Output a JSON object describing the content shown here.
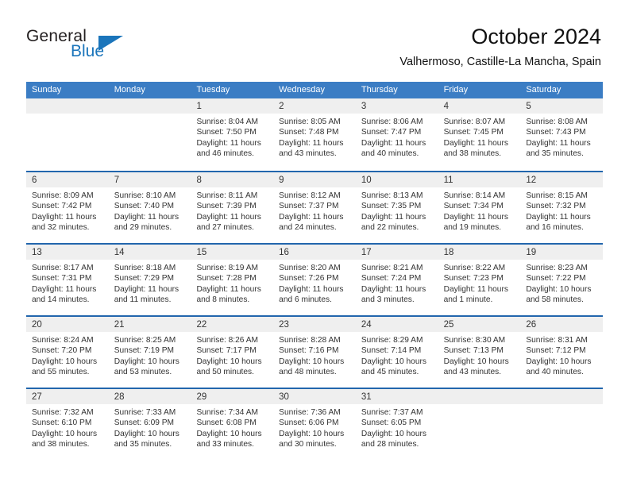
{
  "brand": {
    "word1": "General",
    "word2": "Blue",
    "accent_color": "#1b75bb",
    "triangle_icon": "triangle-logo-icon"
  },
  "header": {
    "title": "October 2024",
    "subtitle": "Valhermoso, Castille-La Mancha, Spain"
  },
  "theme": {
    "header_row_bg": "#3b7dc4",
    "row_divider": "#2266ad",
    "day_band_bg": "#efefef",
    "text": "#333333"
  },
  "weekdays": [
    "Sunday",
    "Monday",
    "Tuesday",
    "Wednesday",
    "Thursday",
    "Friday",
    "Saturday"
  ],
  "weeks": [
    [
      {
        "day": "",
        "sunrise": "",
        "sunset": "",
        "daylight1": "",
        "daylight2": ""
      },
      {
        "day": "",
        "sunrise": "",
        "sunset": "",
        "daylight1": "",
        "daylight2": ""
      },
      {
        "day": "1",
        "sunrise": "Sunrise: 8:04 AM",
        "sunset": "Sunset: 7:50 PM",
        "daylight1": "Daylight: 11 hours",
        "daylight2": "and 46 minutes."
      },
      {
        "day": "2",
        "sunrise": "Sunrise: 8:05 AM",
        "sunset": "Sunset: 7:48 PM",
        "daylight1": "Daylight: 11 hours",
        "daylight2": "and 43 minutes."
      },
      {
        "day": "3",
        "sunrise": "Sunrise: 8:06 AM",
        "sunset": "Sunset: 7:47 PM",
        "daylight1": "Daylight: 11 hours",
        "daylight2": "and 40 minutes."
      },
      {
        "day": "4",
        "sunrise": "Sunrise: 8:07 AM",
        "sunset": "Sunset: 7:45 PM",
        "daylight1": "Daylight: 11 hours",
        "daylight2": "and 38 minutes."
      },
      {
        "day": "5",
        "sunrise": "Sunrise: 8:08 AM",
        "sunset": "Sunset: 7:43 PM",
        "daylight1": "Daylight: 11 hours",
        "daylight2": "and 35 minutes."
      }
    ],
    [
      {
        "day": "6",
        "sunrise": "Sunrise: 8:09 AM",
        "sunset": "Sunset: 7:42 PM",
        "daylight1": "Daylight: 11 hours",
        "daylight2": "and 32 minutes."
      },
      {
        "day": "7",
        "sunrise": "Sunrise: 8:10 AM",
        "sunset": "Sunset: 7:40 PM",
        "daylight1": "Daylight: 11 hours",
        "daylight2": "and 29 minutes."
      },
      {
        "day": "8",
        "sunrise": "Sunrise: 8:11 AM",
        "sunset": "Sunset: 7:39 PM",
        "daylight1": "Daylight: 11 hours",
        "daylight2": "and 27 minutes."
      },
      {
        "day": "9",
        "sunrise": "Sunrise: 8:12 AM",
        "sunset": "Sunset: 7:37 PM",
        "daylight1": "Daylight: 11 hours",
        "daylight2": "and 24 minutes."
      },
      {
        "day": "10",
        "sunrise": "Sunrise: 8:13 AM",
        "sunset": "Sunset: 7:35 PM",
        "daylight1": "Daylight: 11 hours",
        "daylight2": "and 22 minutes."
      },
      {
        "day": "11",
        "sunrise": "Sunrise: 8:14 AM",
        "sunset": "Sunset: 7:34 PM",
        "daylight1": "Daylight: 11 hours",
        "daylight2": "and 19 minutes."
      },
      {
        "day": "12",
        "sunrise": "Sunrise: 8:15 AM",
        "sunset": "Sunset: 7:32 PM",
        "daylight1": "Daylight: 11 hours",
        "daylight2": "and 16 minutes."
      }
    ],
    [
      {
        "day": "13",
        "sunrise": "Sunrise: 8:17 AM",
        "sunset": "Sunset: 7:31 PM",
        "daylight1": "Daylight: 11 hours",
        "daylight2": "and 14 minutes."
      },
      {
        "day": "14",
        "sunrise": "Sunrise: 8:18 AM",
        "sunset": "Sunset: 7:29 PM",
        "daylight1": "Daylight: 11 hours",
        "daylight2": "and 11 minutes."
      },
      {
        "day": "15",
        "sunrise": "Sunrise: 8:19 AM",
        "sunset": "Sunset: 7:28 PM",
        "daylight1": "Daylight: 11 hours",
        "daylight2": "and 8 minutes."
      },
      {
        "day": "16",
        "sunrise": "Sunrise: 8:20 AM",
        "sunset": "Sunset: 7:26 PM",
        "daylight1": "Daylight: 11 hours",
        "daylight2": "and 6 minutes."
      },
      {
        "day": "17",
        "sunrise": "Sunrise: 8:21 AM",
        "sunset": "Sunset: 7:24 PM",
        "daylight1": "Daylight: 11 hours",
        "daylight2": "and 3 minutes."
      },
      {
        "day": "18",
        "sunrise": "Sunrise: 8:22 AM",
        "sunset": "Sunset: 7:23 PM",
        "daylight1": "Daylight: 11 hours",
        "daylight2": "and 1 minute."
      },
      {
        "day": "19",
        "sunrise": "Sunrise: 8:23 AM",
        "sunset": "Sunset: 7:22 PM",
        "daylight1": "Daylight: 10 hours",
        "daylight2": "and 58 minutes."
      }
    ],
    [
      {
        "day": "20",
        "sunrise": "Sunrise: 8:24 AM",
        "sunset": "Sunset: 7:20 PM",
        "daylight1": "Daylight: 10 hours",
        "daylight2": "and 55 minutes."
      },
      {
        "day": "21",
        "sunrise": "Sunrise: 8:25 AM",
        "sunset": "Sunset: 7:19 PM",
        "daylight1": "Daylight: 10 hours",
        "daylight2": "and 53 minutes."
      },
      {
        "day": "22",
        "sunrise": "Sunrise: 8:26 AM",
        "sunset": "Sunset: 7:17 PM",
        "daylight1": "Daylight: 10 hours",
        "daylight2": "and 50 minutes."
      },
      {
        "day": "23",
        "sunrise": "Sunrise: 8:28 AM",
        "sunset": "Sunset: 7:16 PM",
        "daylight1": "Daylight: 10 hours",
        "daylight2": "and 48 minutes."
      },
      {
        "day": "24",
        "sunrise": "Sunrise: 8:29 AM",
        "sunset": "Sunset: 7:14 PM",
        "daylight1": "Daylight: 10 hours",
        "daylight2": "and 45 minutes."
      },
      {
        "day": "25",
        "sunrise": "Sunrise: 8:30 AM",
        "sunset": "Sunset: 7:13 PM",
        "daylight1": "Daylight: 10 hours",
        "daylight2": "and 43 minutes."
      },
      {
        "day": "26",
        "sunrise": "Sunrise: 8:31 AM",
        "sunset": "Sunset: 7:12 PM",
        "daylight1": "Daylight: 10 hours",
        "daylight2": "and 40 minutes."
      }
    ],
    [
      {
        "day": "27",
        "sunrise": "Sunrise: 7:32 AM",
        "sunset": "Sunset: 6:10 PM",
        "daylight1": "Daylight: 10 hours",
        "daylight2": "and 38 minutes."
      },
      {
        "day": "28",
        "sunrise": "Sunrise: 7:33 AM",
        "sunset": "Sunset: 6:09 PM",
        "daylight1": "Daylight: 10 hours",
        "daylight2": "and 35 minutes."
      },
      {
        "day": "29",
        "sunrise": "Sunrise: 7:34 AM",
        "sunset": "Sunset: 6:08 PM",
        "daylight1": "Daylight: 10 hours",
        "daylight2": "and 33 minutes."
      },
      {
        "day": "30",
        "sunrise": "Sunrise: 7:36 AM",
        "sunset": "Sunset: 6:06 PM",
        "daylight1": "Daylight: 10 hours",
        "daylight2": "and 30 minutes."
      },
      {
        "day": "31",
        "sunrise": "Sunrise: 7:37 AM",
        "sunset": "Sunset: 6:05 PM",
        "daylight1": "Daylight: 10 hours",
        "daylight2": "and 28 minutes."
      },
      {
        "day": "",
        "sunrise": "",
        "sunset": "",
        "daylight1": "",
        "daylight2": ""
      },
      {
        "day": "",
        "sunrise": "",
        "sunset": "",
        "daylight1": "",
        "daylight2": ""
      }
    ]
  ]
}
